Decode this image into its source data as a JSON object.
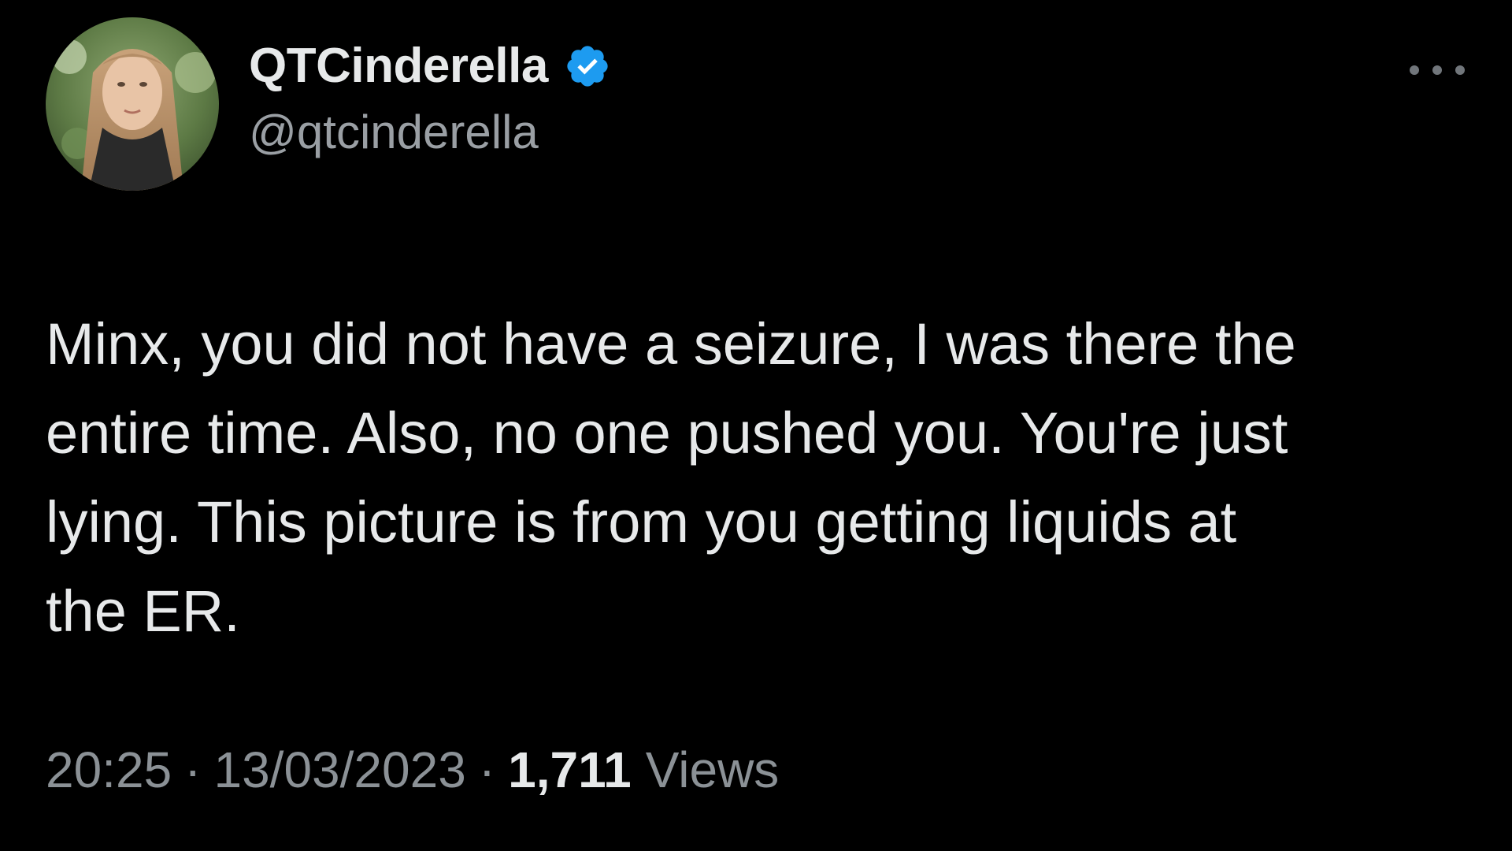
{
  "user": {
    "display_name": "QTCinderella",
    "handle": "@qtcinderella",
    "verified": true,
    "verified_color": "#1d9bf0"
  },
  "tweet": {
    "text": "Minx, you did not have a seizure, I was there the\nentire time. Also, no one pushed you. You're just\nlying. This picture is from you getting liquids at\nthe ER."
  },
  "meta": {
    "time": "20:25",
    "separator": "·",
    "date": "13/03/2023",
    "views_count": "1,711",
    "views_label": "Views"
  },
  "icons": {
    "more": "more-options-icon",
    "verified": "verified-badge-icon"
  },
  "colors": {
    "background": "#000000",
    "primary_text": "#e7e9ea",
    "secondary_text": "#8b9196"
  }
}
